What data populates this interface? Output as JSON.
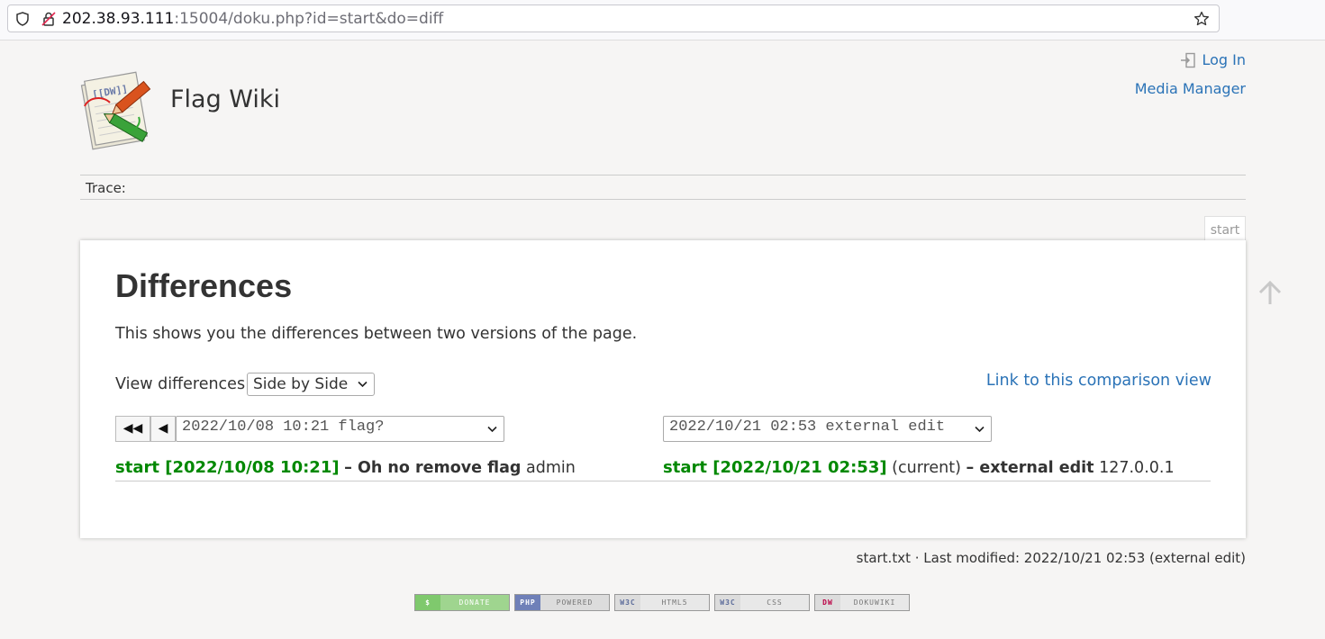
{
  "browser": {
    "url_host": "202.38.93.111",
    "url_rest": ":15004/doku.php?id=start&do=diff"
  },
  "header": {
    "site_title": "Flag Wiki",
    "login_label": "Log In",
    "media_manager_label": "Media Manager",
    "trace_label": "Trace:"
  },
  "page_tab": "start",
  "content": {
    "heading": "Differences",
    "intro": "This shows you the differences between two versions of the page.",
    "view_label": "View differences:",
    "view_selected": "Side by Side",
    "compare_link": "Link to this comparison view",
    "nav_first": "◀◀",
    "nav_prev": "◀",
    "left_revision_select": "2022/10/08 10:21 flag?",
    "right_revision_select": "2022/10/21 02:53 external edit",
    "left_info": {
      "page_link": "start [2022/10/08 10:21]",
      "summary": "– Oh no remove flag",
      "user": "admin"
    },
    "right_info": {
      "page_link": "start [2022/10/21 02:53]",
      "current": "(current)",
      "summary": "– external edit",
      "user": "127.0.0.1"
    }
  },
  "doc_info": "start.txt · Last modified: 2022/10/21 02:53 (external edit)",
  "footer_badges": [
    {
      "icon": "$",
      "text": "DONATE"
    },
    {
      "icon": "PHP",
      "text": "POWERED"
    },
    {
      "icon": "W3C",
      "text": "HTML5"
    },
    {
      "icon": "W3C",
      "text": "CSS"
    },
    {
      "icon": "DW",
      "text": "DOKUWIKI"
    }
  ],
  "colors": {
    "link": "#2b73b7",
    "revision_green": "#008800",
    "background": "#f6f5f4"
  }
}
